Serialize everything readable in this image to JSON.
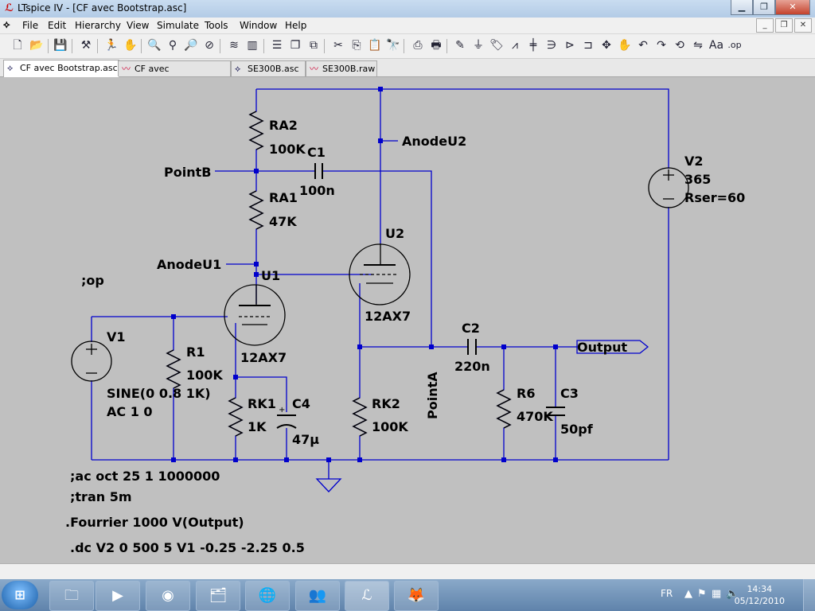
{
  "window": {
    "title": "LTspice IV - [CF avec Bootstrap.asc]"
  },
  "menu": [
    "File",
    "Edit",
    "Hierarchy",
    "View",
    "Simulate",
    "Tools",
    "Window",
    "Help"
  ],
  "toolbar_icons": [
    "new-schematic-icon",
    "open-icon",
    "save-icon",
    "control-panel-icon",
    "run-icon",
    "halt-icon",
    "zoom-in-icon",
    "zoom-fit-icon",
    "zoom-out-icon",
    "zoom-cancel-icon",
    "autorange-icon",
    "tile-vertical-icon",
    "cascade-icon",
    "tile-horizontal-icon",
    "cut-icon",
    "copy-icon",
    "paste-icon",
    "find-icon",
    "print-setup-icon",
    "print-icon",
    "wire-icon",
    "ground-icon",
    "label-icon",
    "resistor-icon",
    "capacitor-icon",
    "inductor-icon",
    "diode-icon",
    "component-icon",
    "move-icon",
    "drag-icon",
    "undo-icon",
    "redo-icon",
    "rotate-icon",
    "mirror-icon",
    "text-icon",
    "spice-directive-icon"
  ],
  "tabs": [
    {
      "label": "CF avec Bootstrap.asc",
      "icon": "schematic-icon",
      "active": true
    },
    {
      "label": "CF avec Bootstrap.raw",
      "icon": "waveform-icon",
      "active": false
    },
    {
      "label": "SE300B.asc",
      "icon": "schematic-icon",
      "active": false
    },
    {
      "label": "SE300B.raw",
      "icon": "waveform-icon",
      "active": false
    }
  ],
  "schematic": {
    "labels": {
      "ra2_name": "RA2",
      "ra2_val": "100K",
      "c1_name": "C1",
      "c1_val": "100n",
      "ra1_name": "RA1",
      "ra1_val": "47K",
      "pointb": "PointB",
      "anodeu2": "AnodeU2",
      "anodeu1": "AnodeU1",
      "u1_name": "U1",
      "u1_val": "12AX7",
      "u2_name": "U2",
      "u2_val": "12AX7",
      "op": ";op",
      "v1_name": "V1",
      "r1_name": "R1",
      "r1_val": "100K",
      "v1_sine": "SINE(0 0.8 1K)",
      "v1_ac": "AC 1 0",
      "rk1_name": "RK1",
      "rk1_val": "1K",
      "c4_name": "C4",
      "c4_val": "47µ",
      "rk2_name": "RK2",
      "rk2_val": "100K",
      "pointa": "PointA",
      "c2_name": "C2",
      "c2_val": "220n",
      "r6_name": "R6",
      "r6_val": "470K",
      "c3_name": "C3",
      "c3_val": "50pf",
      "output": "Output",
      "v2_name": "V2",
      "v2_val": "365",
      "v2_rser": "Rser=60"
    },
    "directives": [
      ";ac oct 25 1 1000000",
      ";tran 5m",
      ".Fourrier 1000 V(Output)",
      ".dc V2 0 500 5 V1 -0.25 -2.25 0.5"
    ],
    "wire_color": "#0000cc",
    "background": "#c0c0c0"
  },
  "taskbar": {
    "apps": [
      "explorer-icon",
      "media-player-icon",
      "app-icon",
      "folder-icon",
      "firefox-icon",
      "messenger-icon",
      "ltspice-icon",
      "gimp-icon"
    ],
    "language": "FR",
    "time": "14:34",
    "date": "05/12/2010"
  }
}
